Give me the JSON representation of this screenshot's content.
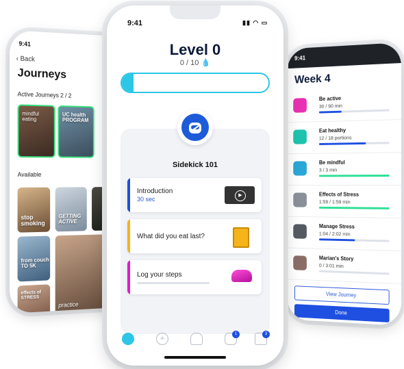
{
  "left_phone": {
    "time": "9:41",
    "back_label": "Back",
    "title": "Journeys",
    "active_label": "Active Journeys 2 / 2",
    "available_label": "Available",
    "active_cards": [
      "mindful eating",
      "UC health PROGRAM"
    ],
    "available_cards": [
      "stop smoking",
      "GETTING ACTIVE",
      "from couch TO 5K",
      "effects of STRESS",
      "practice"
    ]
  },
  "center_phone": {
    "time": "9:41",
    "level_title": "Level 0",
    "points": "0 / 10",
    "progress": 0.08,
    "module_title": "Sidekick 101",
    "tasks": [
      {
        "label": "Introduction",
        "sub": "30 sec",
        "color": "#1e4fe0"
      },
      {
        "label": "What did you eat last?",
        "sub": "",
        "color": "#f7b21b"
      },
      {
        "label": "Log your steps",
        "sub": "",
        "color": "#e21ac7"
      }
    ],
    "nav_badges": [
      "1",
      "3"
    ]
  },
  "right_phone": {
    "time": "9:41",
    "title": "Week 4",
    "items": [
      {
        "name": "Be active",
        "progress_text": "30 / 90 min",
        "fraction": 0.33,
        "fill": "#1e4fe0",
        "icon_color": "#e830b3"
      },
      {
        "name": "Eat healthy",
        "progress_text": "12 / 18 portions",
        "fraction": 0.67,
        "fill": "#1e4fe0",
        "icon_color": "#1fc3ad"
      },
      {
        "name": "Be mindful",
        "progress_text": "3 / 3 min",
        "fraction": 1.0,
        "fill": "#2de096",
        "icon_color": "#2aa7d6"
      },
      {
        "name": "Effects of Stress",
        "progress_text": "1:59 / 1:59 min",
        "fraction": 1.0,
        "fill": "#2de096",
        "icon_color": "#8a8f99"
      },
      {
        "name": "Manage Stress",
        "progress_text": "1:04 / 2:02 min",
        "fraction": 0.52,
        "fill": "#1e4fe0",
        "icon_color": "#555a62"
      },
      {
        "name": "Marian's Story",
        "progress_text": "0 / 3:01 min",
        "fraction": 0.0,
        "fill": "#1e4fe0",
        "icon_color": "#8a6d66"
      }
    ],
    "view_label": "View Journey",
    "done_label": "Done"
  }
}
